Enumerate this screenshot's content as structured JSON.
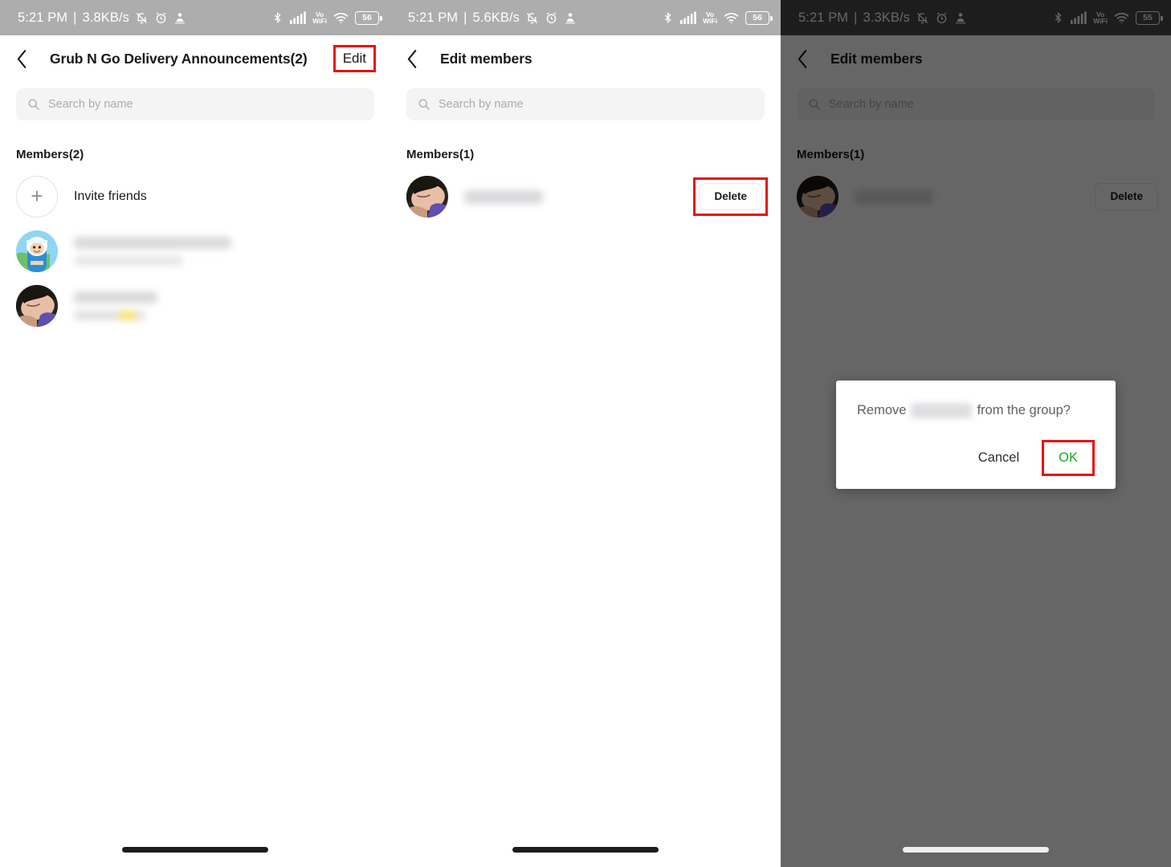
{
  "panels": [
    {
      "id": "group-detail",
      "status": {
        "time": "5:21 PM",
        "separator": "|",
        "net_speed": "3.8KB/s",
        "battery": "55",
        "battery_label": "56",
        "vowifi": [
          "Vo",
          "WiFi"
        ]
      },
      "appbar": {
        "title": "Grub N Go Delivery Announcements(2)",
        "action_label": "Edit",
        "back_icon": "chevron-left-icon"
      },
      "search": {
        "placeholder": "Search by name",
        "icon": "search-icon"
      },
      "section_title": "Members(2)",
      "invite": {
        "label": "Invite friends",
        "icon": "plus-icon"
      },
      "members": [
        {
          "name_redacted": true,
          "subtitle_redacted": true,
          "avatar": "cartoon-avatar"
        },
        {
          "name_redacted": true,
          "subtitle_redacted": true,
          "avatar": "photo-avatar"
        }
      ],
      "highlight": "edit-button"
    },
    {
      "id": "edit-members",
      "status": {
        "time": "5:21 PM",
        "separator": "|",
        "net_speed": "5.6KB/s",
        "battery_label": "56",
        "vowifi": [
          "Vo",
          "WiFi"
        ]
      },
      "appbar": {
        "title": "Edit members",
        "back_icon": "chevron-left-icon"
      },
      "search": {
        "placeholder": "Search by name",
        "icon": "search-icon"
      },
      "section_title": "Members(1)",
      "members": [
        {
          "name_redacted": true,
          "avatar": "photo-avatar",
          "action_label": "Delete"
        }
      ],
      "highlight": "delete-button"
    },
    {
      "id": "edit-members-confirm",
      "status": {
        "time": "5:21 PM",
        "separator": "|",
        "net_speed": "3.3KB/s",
        "battery_label": "55",
        "vowifi": [
          "Vo",
          "WiFi"
        ]
      },
      "appbar": {
        "title": "Edit members",
        "back_icon": "chevron-left-icon"
      },
      "search": {
        "placeholder": "Search by name",
        "icon": "search-icon"
      },
      "section_title": "Members(1)",
      "members": [
        {
          "name_redacted": true,
          "avatar": "photo-avatar",
          "action_label": "Delete"
        }
      ],
      "dialog": {
        "message_prefix": "Remove",
        "message_suffix": "from the group?",
        "subject_redacted": true,
        "cancel_label": "Cancel",
        "ok_label": "OK"
      },
      "highlight": "ok-button"
    }
  ],
  "colors": {
    "highlight_red": "#e81010",
    "ok_green": "#18a81c",
    "statusbar_gray": "#adadad",
    "statusbar_gray_dim": "#4a4a4a",
    "search_bg": "#f4f4f5",
    "text_primary": "#16181c",
    "text_muted": "#a9abaf",
    "scrim": "rgba(0,0,0,0.60)"
  }
}
